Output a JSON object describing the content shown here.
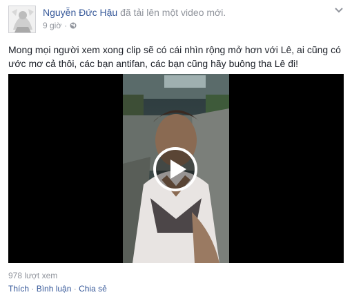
{
  "post": {
    "author": "Nguyễn Đức Hậu",
    "action_text": " đã tải lên một video mới.",
    "time": "9 giờ",
    "time_separator": "·",
    "privacy_icon": "globe-icon",
    "menu_icon": "chevron-down-icon",
    "text_line1": "Mong mọi người xem xong clip sẽ có cái nhìn rộng mở hơn với Lê, ai cũng có",
    "text_line2": "ước mơ cả thôi, các bạn antifan, các bạn cũng hãy buông tha Lê đi!",
    "video": {
      "play_icon": "play-icon"
    },
    "views": "978 lượt xem",
    "actions": {
      "like": "Thích",
      "comment": "Bình luận",
      "share": "Chia sẻ",
      "separator": " · "
    }
  },
  "colors": {
    "link": "#365899",
    "secondary_text": "#90949c",
    "body_text": "#1d2129",
    "video_bg": "#000000"
  }
}
